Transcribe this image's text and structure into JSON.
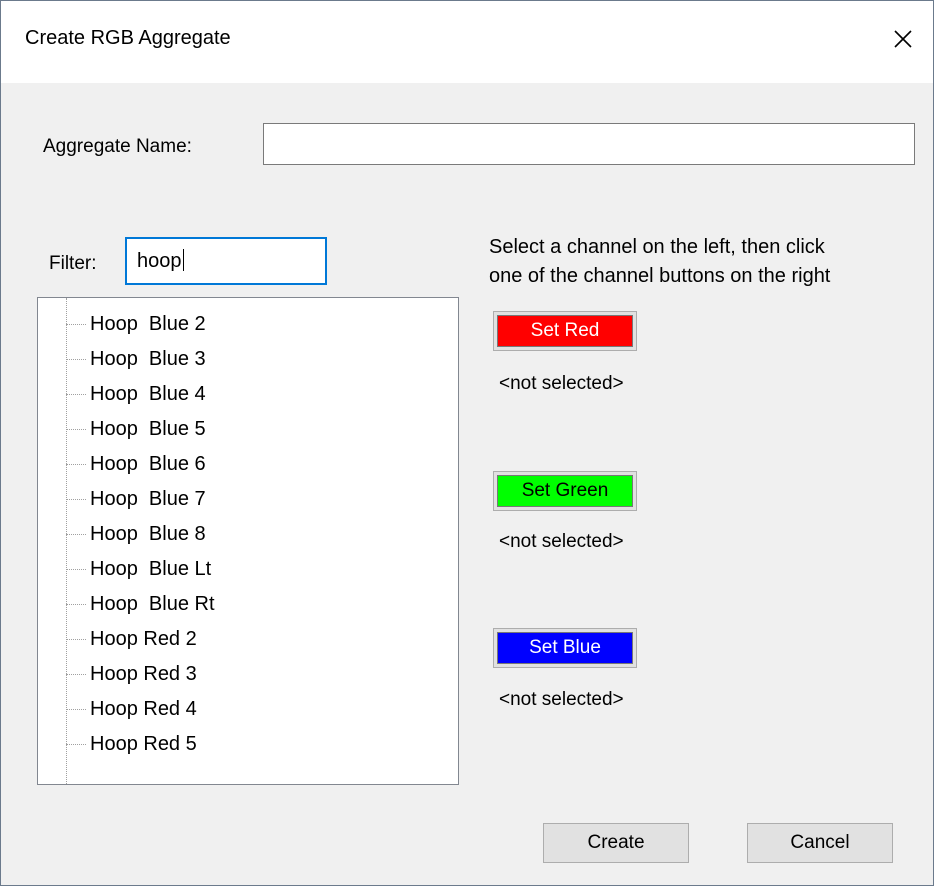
{
  "dialog": {
    "title": "Create RGB Aggregate",
    "aggregate_name_label": "Aggregate Name:",
    "aggregate_name_value": "",
    "filter_label": "Filter:",
    "filter_value": "hoop",
    "instructions": [
      "Select a channel on the left, then click",
      "one of the channel buttons on the right"
    ]
  },
  "channels": [
    {
      "button_label": "Set Red",
      "color": "#ff0000",
      "status": "<not selected>"
    },
    {
      "button_label": "Set Green",
      "color": "#00ff00",
      "status": "<not selected>"
    },
    {
      "button_label": "Set Blue",
      "color": "#0000ff",
      "status": "<not selected>"
    }
  ],
  "list": {
    "items": [
      "Hoop  Blue 2",
      "Hoop  Blue 3",
      "Hoop  Blue 4",
      "Hoop  Blue 5",
      "Hoop  Blue 6",
      "Hoop  Blue 7",
      "Hoop  Blue 8",
      "Hoop  Blue Lt",
      "Hoop  Blue Rt",
      "Hoop Red 2",
      "Hoop Red 3",
      "Hoop Red 4",
      "Hoop Red 5"
    ]
  },
  "buttons": {
    "create": "Create",
    "cancel": "Cancel"
  },
  "icons": {
    "close": "close-icon",
    "scroll_up": "chevron-up-icon",
    "scroll_down": "chevron-down-icon"
  }
}
